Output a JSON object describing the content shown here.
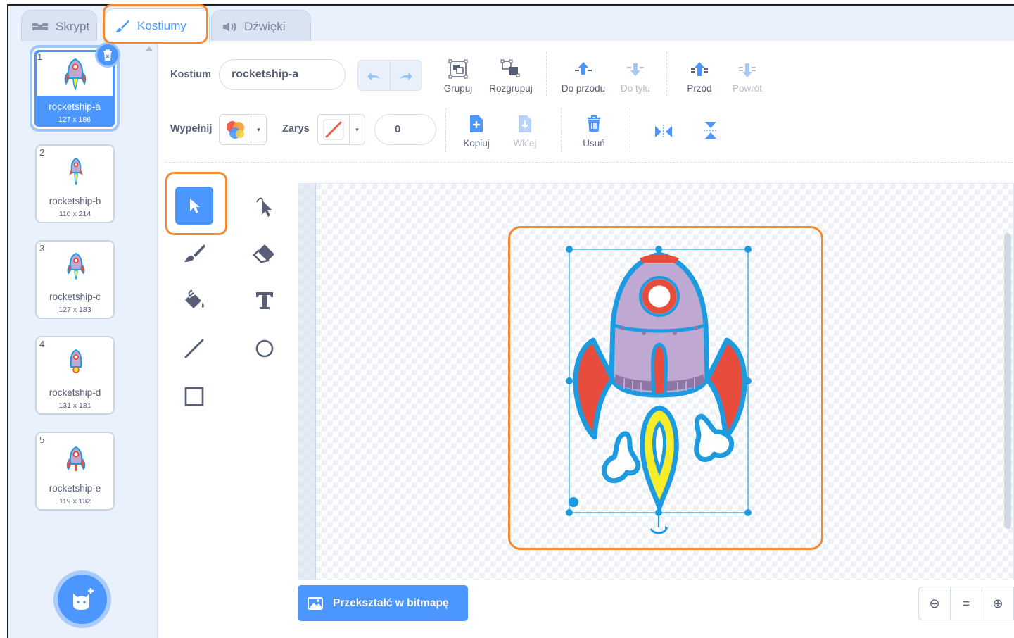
{
  "tabs": [
    {
      "label": "Skrypt",
      "icon": "code-icon"
    },
    {
      "label": "Kostiumy",
      "icon": "brush-icon",
      "active": true
    },
    {
      "label": "Dźwięki",
      "icon": "speaker-icon"
    }
  ],
  "costumes": [
    {
      "number": "1",
      "name": "rocketship-a",
      "size": "127 x 186",
      "selected": true
    },
    {
      "number": "2",
      "name": "rocketship-b",
      "size": "110 x 214"
    },
    {
      "number": "3",
      "name": "rocketship-c",
      "size": "127 x 183"
    },
    {
      "number": "4",
      "name": "rocketship-d",
      "size": "131 x 181"
    },
    {
      "number": "5",
      "name": "rocketship-e",
      "size": "119 x 132"
    }
  ],
  "editor": {
    "costume_label": "Kostium",
    "costume_name": "rocketship-a",
    "fill_label": "Wypełnij",
    "outline_label": "Zarys",
    "outline_width": "0",
    "toolbar": {
      "group": "Grupuj",
      "ungroup": "Rozgrupuj",
      "forward": "Do przodu",
      "backward": "Do tyłu",
      "front": "Przód",
      "back": "Powrót",
      "copy": "Kopiuj",
      "paste": "Wklej",
      "delete": "Usuń"
    },
    "convert_button": "Przekształć w bitmapę",
    "zoom": {
      "out": "⊖",
      "reset": "=",
      "in": "⊕"
    }
  },
  "colors": {
    "accent": "#4c97ff",
    "highlight": "#f5892f",
    "rocket_body": "#bfa9d3",
    "rocket_red": "#e84c3d",
    "rocket_outline": "#1d9be0",
    "flame": "#f7ec2a"
  }
}
